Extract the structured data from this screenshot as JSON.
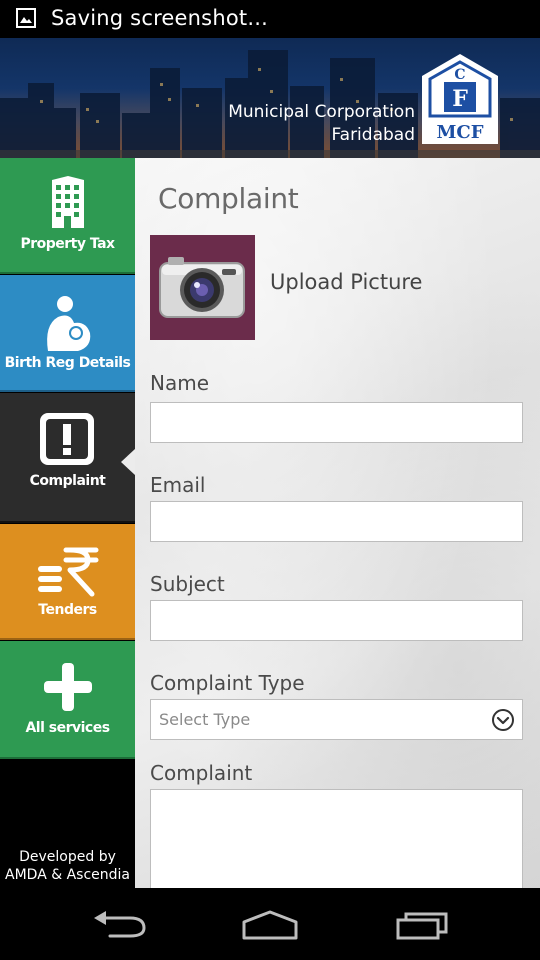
{
  "status_bar": {
    "text": "Saving screenshot...",
    "icon": "image-icon"
  },
  "header": {
    "org_line1": "Municipal Corporation",
    "org_line2": "Faridabad",
    "logo_text": "MCF"
  },
  "sidebar": {
    "items": [
      {
        "label": "Property Tax",
        "icon": "building-icon",
        "color": "#2e9a52"
      },
      {
        "label": "Birth Reg Details",
        "icon": "mother-child-icon",
        "color": "#2d8cc4"
      },
      {
        "label": "Complaint",
        "icon": "exclamation-icon",
        "color": "#2c2c2c",
        "selected": true
      },
      {
        "label": "Tenders",
        "icon": "rupee-icon",
        "color": "#dd8f1f"
      },
      {
        "label": "All services",
        "icon": "plus-icon",
        "color": "#2e9a52"
      }
    ],
    "credit_line1": "Developed by",
    "credit_line2": "AMDA & Ascendia"
  },
  "form": {
    "title": "Complaint",
    "upload_label": "Upload Picture",
    "name_label": "Name",
    "email_label": "Email",
    "subject_label": "Subject",
    "type_label": "Complaint Type",
    "type_placeholder": "Select Type",
    "complaint_label": "Complaint"
  },
  "nav": {
    "back": "back-icon",
    "home": "home-icon",
    "recents": "recents-icon"
  }
}
